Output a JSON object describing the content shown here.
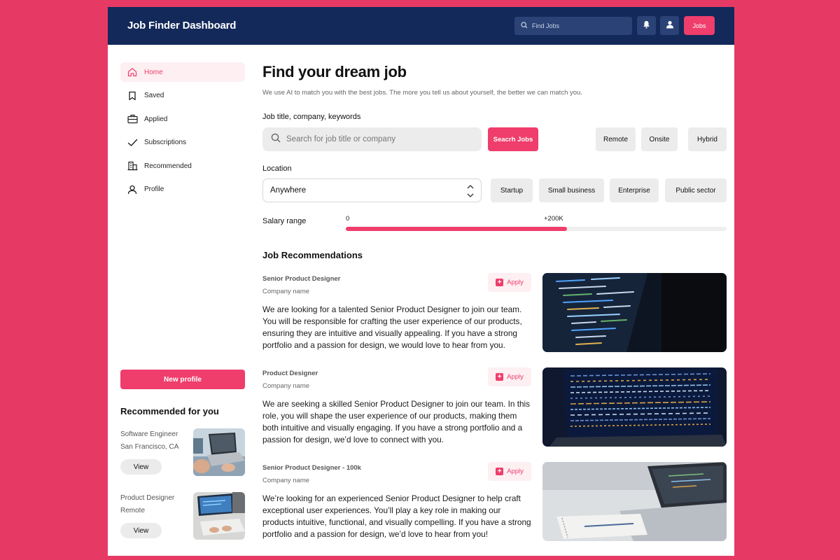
{
  "app": {
    "title": "Job Finder Dashboard"
  },
  "topbar": {
    "search_placeholder": "Find Jobs",
    "jobs_label": "Jobs",
    "icons": [
      "search-icon",
      "bell-icon",
      "user-icon"
    ]
  },
  "sidebar": {
    "items": [
      {
        "label": "Home",
        "icon": "home-icon",
        "active": true
      },
      {
        "label": "Saved",
        "icon": "bookmark-icon",
        "active": false
      },
      {
        "label": "Applied",
        "icon": "briefcase-icon",
        "active": false
      },
      {
        "label": "Subscriptions",
        "icon": "check-icon",
        "active": false
      },
      {
        "label": "Recommended",
        "icon": "building-icon",
        "active": false
      },
      {
        "label": "Profile",
        "icon": "user-icon",
        "active": false
      }
    ],
    "new_profile_label": "New profile",
    "recommended_title": "Recommended for you",
    "recommended": [
      {
        "title": "Software Engineer",
        "subtitle": "San Francisco, CA",
        "view_label": "View"
      },
      {
        "title": "Product Designer",
        "subtitle": "Remote",
        "view_label": "View"
      }
    ]
  },
  "main": {
    "title": "Find your dream job",
    "subtitle": "We use AI to match you with the best jobs. The more you tell us about yourself, the better we can match you.",
    "keyword_label": "Job title, company, keywords",
    "search_placeholder": "Search for job title or company",
    "search_button": "Seacrh Jobs",
    "work_types": [
      "Remote",
      "Onsite",
      "Hybrid"
    ],
    "location_label": "Location",
    "location_value": "Anywhere",
    "company_types": [
      "Startup",
      "Small business",
      "Enterprise",
      "Public sector"
    ],
    "salary_label": "Salary range",
    "salary_min": "0",
    "salary_max": "+200K",
    "salary_fill_fraction": 0.58,
    "recommendations_title": "Job Recommendations",
    "jobs": [
      {
        "title": "Senior Product Designer",
        "company": "Company name",
        "apply_label": "Apply",
        "description": "We are looking for a talented Senior Product Designer to join our team. You will be responsible for crafting the user experience of our products, ensuring they are intuitive and visually appealing. If you have a strong portfolio and a passion for design, we would love to hear from you."
      },
      {
        "title": "Product Designer",
        "company": "Company name",
        "apply_label": "Apply",
        "description": "We are seeking a skilled Senior Product Designer to join our team. In this role, you will shape the user experience of our products, making them both intuitive and visually engaging. If you have a strong portfolio and a passion for design, we’d love to connect with you."
      },
      {
        "title": "Senior Product Designer - 100k",
        "company": "Company name",
        "apply_label": "Apply",
        "description": "We’re looking for an experienced Senior Product Designer to help craft exceptional user experiences. You’ll play a key role in making our products intuitive, functional, and visually compelling. If you have a strong portfolio and a passion for design, we’d love to hear from you!"
      }
    ]
  },
  "colors": {
    "background": "#e63a64",
    "navbar": "#12295a",
    "accent": "#ef3d6c"
  }
}
